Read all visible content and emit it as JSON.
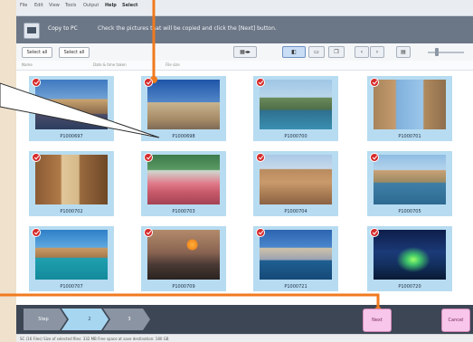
{
  "colors": {
    "accent_orange": "#f07a1e",
    "tile_blue": "#b7dcf1",
    "top_bar": "#6b7686",
    "bottom_bar": "#3d4654",
    "button_pink": "#f7c6ea"
  },
  "menu": {
    "items": [
      "File",
      "Edit",
      "View",
      "Tools",
      "Output",
      "Help",
      "Select"
    ]
  },
  "header": {
    "title": "Copy to PC",
    "instruction": "Check the pictures that will be copied and click the [Next] button."
  },
  "toolbar": {
    "select_all": "Select all",
    "deselect_all": "Select all"
  },
  "sort": {
    "labels": [
      "Name",
      "Date & time taken",
      "File size"
    ]
  },
  "tools": [
    "view-list-icon",
    "view-thumbnail-icon",
    "frame-icon",
    "copy-icon",
    "prev-icon",
    "next-icon",
    "zoom-icon"
  ],
  "photos": [
    {
      "name": "P1000697",
      "icon": "check-icon",
      "scene": "harbor"
    },
    {
      "name": "P1000698",
      "icon": "check-icon",
      "scene": "square"
    },
    {
      "name": "P1000700",
      "icon": "check-icon",
      "scene": "bridge"
    },
    {
      "name": "P1000701",
      "icon": "check-icon",
      "scene": "street"
    },
    {
      "name": "P1000702",
      "icon": "check-icon",
      "scene": "alley"
    },
    {
      "name": "P1000703",
      "icon": "check-icon",
      "scene": "cafe"
    },
    {
      "name": "P1000704",
      "icon": "check-icon",
      "scene": "city"
    },
    {
      "name": "P1000705",
      "icon": "check-icon",
      "scene": "coast"
    },
    {
      "name": "P1000707",
      "icon": "check-icon",
      "scene": "canal"
    },
    {
      "name": "P1000709",
      "icon": "check-icon",
      "scene": "sunset"
    },
    {
      "name": "P1000721",
      "icon": "check-icon",
      "scene": "waterfront"
    },
    {
      "name": "P1000720",
      "icon": "check-icon",
      "scene": "night"
    }
  ],
  "steps": [
    {
      "label": "Step"
    },
    {
      "label": "2"
    },
    {
      "label": "3"
    }
  ],
  "actions": {
    "next": "Next",
    "cancel": "Cancel"
  },
  "status": {
    "text": "SC (16 Files)   Size of selected files: 332 MB   Free space at save destination: 180 GB"
  }
}
